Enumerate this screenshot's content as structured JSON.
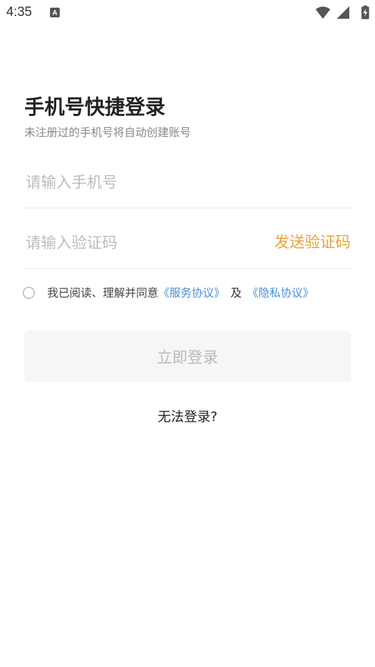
{
  "status_bar": {
    "time": "4:35",
    "notification_icon": "a-keyboard-icon",
    "icons": [
      "wifi-icon",
      "signal-icon",
      "battery-charging-icon"
    ]
  },
  "header": {
    "title": "手机号快捷登录",
    "subtitle": "未注册过的手机号将自动创建账号"
  },
  "form": {
    "phone_placeholder": "请输入手机号",
    "phone_value": "",
    "code_placeholder": "请输入验证码",
    "code_value": "",
    "send_code_label": "发送验证码"
  },
  "agreement": {
    "checked": false,
    "prefix": "我已阅读、理解并同意",
    "service_link": "《服务协议》",
    "conjunction": "及",
    "privacy_link": "《隐私协议》"
  },
  "actions": {
    "login_label": "立即登录",
    "cannot_login_label": "无法登录?"
  },
  "colors": {
    "accent_orange": "#e8a33b",
    "link_blue": "#4a8fd6",
    "button_disabled_bg": "#f5f6f8"
  }
}
